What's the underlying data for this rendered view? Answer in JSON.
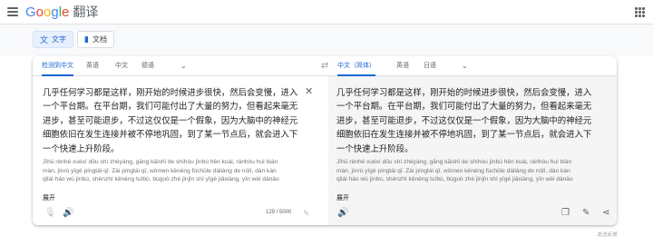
{
  "header": {
    "logo_text": "Google",
    "product": "翻译"
  },
  "modes": {
    "text_label": "文字",
    "docs_label": "文档"
  },
  "source_langs": {
    "detect": "检测到中文",
    "items": [
      "英语",
      "中文",
      "德语"
    ]
  },
  "target_langs": {
    "items": [
      "中文（简体）",
      "英语",
      "日语"
    ]
  },
  "source": {
    "lines": [
      "几乎任何学习都是这样，刚开始的时候进步很快，然后会变慢，进入",
      "一个平台期。在平台期，我们可能付出了大量的努力，但看起来毫无",
      "进步，甚至可能退步，不过这仅仅是一个假象，因为大脑中的神经元",
      "细胞依旧在发生连接并被不停地巩固，到了某一节点后，就会进入下",
      "一个快速上升阶段。"
    ],
    "pinyin": [
      "Jīhū rènhé xuéxí dōu shì zhèyàng, gāng kāishǐ de shíhòu jìnbù hěn kuài, ránhòu huì biàn",
      "màn, jìnrù yīgè píngtái qī. Zài píngtái qī, wǒmen kěnéng fùchūle dàliàng de nǔlì, dàn kàn",
      "qǐlái háo wú jìnbù, shènzhì kěnéng tuìbù, bùguò zhè jǐnjǐn shì yīgè jiǎxiàng, yīn wèi dànǎo"
    ],
    "expand_label": "展开",
    "char_count": "129 / 5000"
  },
  "target": {
    "lines": [
      "几乎任何学习都是这样，刚开始的时候进步很快，然后会变慢，进入",
      "一个平台期。在平台期，我们可能付出了大量的努力，但看起来毫无",
      "进步，甚至可能退步，不过这仅仅是一个假象，因为大脑中的神经元",
      "细胞依旧在发生连接并被不停地巩固，到了某一节点后，就会进入下",
      "一个快速上升阶段。"
    ],
    "pinyin": [
      "Jīhū rènhé xuéxí dōu shì zhèyàng, gāng kāishǐ de shíhòu jìnbù hěn kuài, ránhòu huì biàn",
      "màn, jìnrù yīgè píngtái qī. Zài píngtái qī, wǒmen kěnéng fùchūle dàliàng de nǔlì, dàn kàn",
      "qǐlái háo wú jìnbù, shènzhì kěnéng tuìbù, bùguò zhè jǐnjǐn shì yīgè jiǎxiàng, yīn wèi dànǎo"
    ],
    "expand_label": "展开"
  },
  "footer": {
    "feedback": "发送反馈"
  },
  "colors": {
    "accent": "#1967d2",
    "target_bg": "#f5f5f5"
  }
}
